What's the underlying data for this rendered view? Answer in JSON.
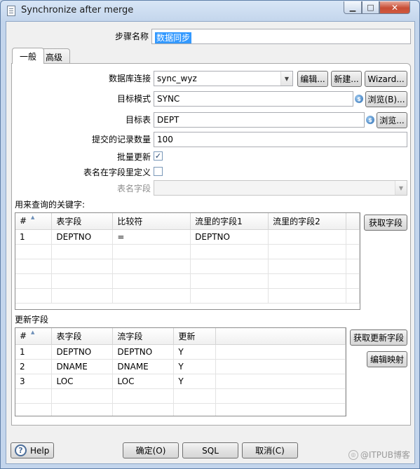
{
  "window": {
    "title": "Synchronize after merge",
    "controls": {
      "minimize": "▁",
      "maximize": "□",
      "close": "✕"
    }
  },
  "step_name": {
    "label": "步骤名称",
    "value": "数据同步"
  },
  "tabs": [
    {
      "label": "一般",
      "active": true
    },
    {
      "label": "高级",
      "active": false
    }
  ],
  "general": {
    "connection": {
      "label": "数据库连接",
      "value": "sync_wyz",
      "edit_label": "编辑...",
      "new_label": "新建...",
      "wizard_label": "Wizard..."
    },
    "target_schema": {
      "label": "目标模式",
      "value": "SYNC",
      "browse_label": "浏览(B)..."
    },
    "target_table": {
      "label": "目标表",
      "value": "DEPT",
      "browse_label": "浏览..."
    },
    "commit_size": {
      "label": "提交的记录数量",
      "value": "100"
    },
    "batch_update": {
      "label": "批量更新",
      "checked": true
    },
    "tablename_in_field": {
      "label": "表名在字段里定义",
      "checked": false
    },
    "tablename_field": {
      "label": "表名字段",
      "value": ""
    }
  },
  "keys_section": {
    "title": "用来查询的关键字:",
    "get_fields_label": "获取字段",
    "columns": [
      "#",
      "表字段",
      "比较符",
      "流里的字段1",
      "流里的字段2"
    ],
    "rows": [
      [
        "1",
        "DEPTNO",
        "=",
        "DEPTNO",
        ""
      ]
    ]
  },
  "update_section": {
    "title": "更新字段",
    "get_update_fields_label": "获取更新字段",
    "edit_mapping_label": "编辑映射",
    "columns": [
      "#",
      "表字段",
      "流字段",
      "更新"
    ],
    "rows": [
      [
        "1",
        "DEPTNO",
        "DEPTNO",
        "Y"
      ],
      [
        "2",
        "DNAME",
        "DNAME",
        "Y"
      ],
      [
        "3",
        "LOC",
        "LOC",
        "Y"
      ]
    ]
  },
  "footer": {
    "help_label": "Help",
    "ok_label": "确定(O)",
    "sql_label": "SQL",
    "cancel_label": "取消(C)"
  },
  "watermark": "@ITPUB博客",
  "colors": {
    "accent": "#3399ff",
    "title_bar": "#c3d5ec",
    "close_button": "#c74d35"
  }
}
